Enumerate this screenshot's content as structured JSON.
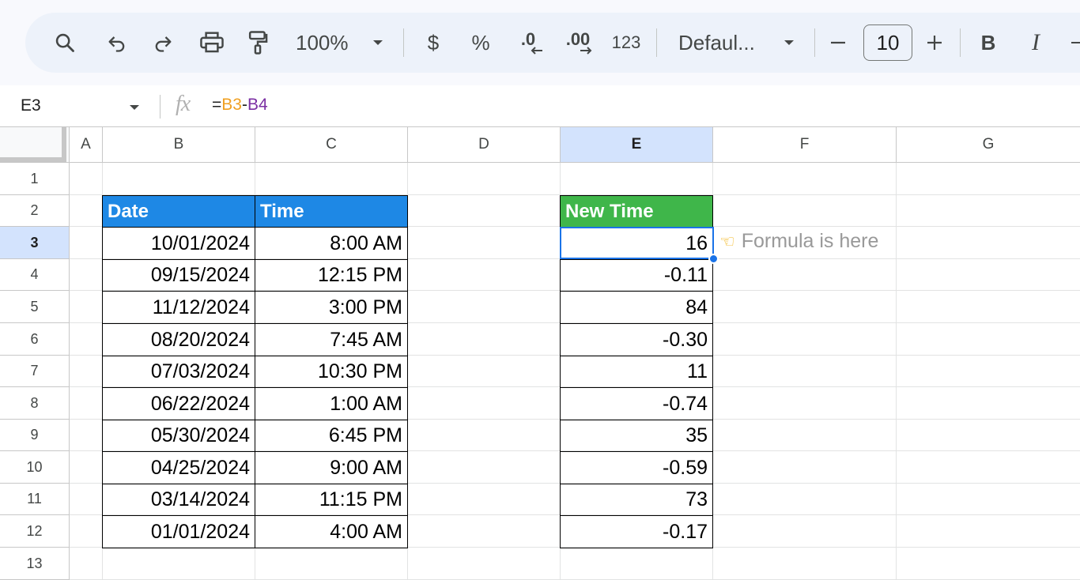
{
  "toolbar": {
    "zoom": "100%",
    "currency_label": "$",
    "percent_label": "%",
    "decrease_decimal_label": ".0",
    "increase_decimal_label": ".00",
    "more_formats_label": "123",
    "font_name": "Defaul...",
    "font_size": "10",
    "bold_label": "B",
    "italic_label": "I"
  },
  "formula_bar": {
    "name_box": "E3",
    "fx": "fx",
    "formula_eq": "=",
    "formula_ref1": "B3",
    "formula_minus": "-",
    "formula_ref2": "B4"
  },
  "sheet": {
    "columns": [
      "A",
      "B",
      "C",
      "D",
      "E",
      "F",
      "G"
    ],
    "active_column": "E",
    "rows": [
      "1",
      "2",
      "3",
      "4",
      "5",
      "6",
      "7",
      "8",
      "9",
      "10",
      "11",
      "12",
      "13"
    ],
    "active_row": "3",
    "table": {
      "headers": {
        "date": "Date",
        "time": "Time",
        "new_time": "New Time"
      },
      "dates": [
        "10/01/2024",
        "09/15/2024",
        "11/12/2024",
        "08/20/2024",
        "07/03/2024",
        "06/22/2024",
        "05/30/2024",
        "04/25/2024",
        "03/14/2024",
        "01/01/2024"
      ],
      "times": [
        "8:00 AM",
        "12:15 PM",
        "3:00 PM",
        "7:45 AM",
        "10:30 PM",
        "1:00 AM",
        "6:45 PM",
        "9:00 AM",
        "11:15 PM",
        "4:00 AM"
      ],
      "new_times": [
        "16",
        "-0.11",
        "84",
        "-0.30",
        "11",
        "-0.74",
        "35",
        "-0.59",
        "73",
        "-0.17"
      ]
    },
    "note": "Formula is here",
    "colors": {
      "date_header": "#1e88e5",
      "new_time_header": "#3fb64a",
      "selection": "#1a73e8"
    }
  }
}
